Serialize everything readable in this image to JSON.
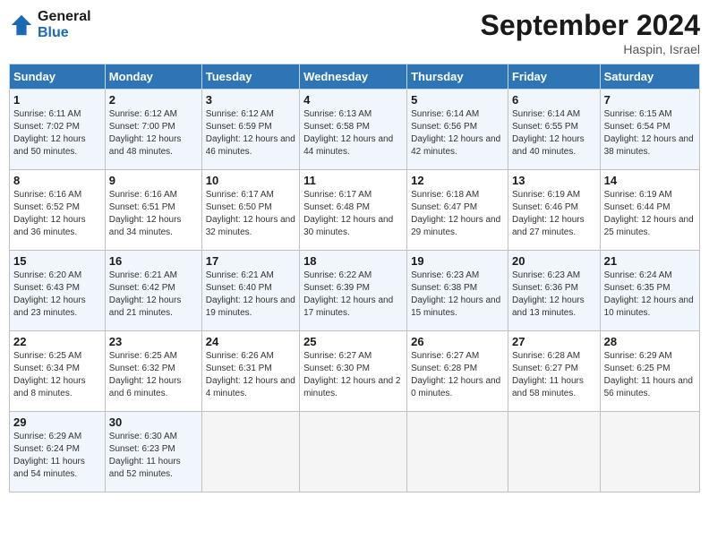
{
  "logo": {
    "line1": "General",
    "line2": "Blue"
  },
  "title": "September 2024",
  "location": "Haspin, Israel",
  "days_header": [
    "Sunday",
    "Monday",
    "Tuesday",
    "Wednesday",
    "Thursday",
    "Friday",
    "Saturday"
  ],
  "weeks": [
    [
      {
        "day": "1",
        "sunrise": "6:11 AM",
        "sunset": "7:02 PM",
        "daylight": "12 hours and 50 minutes."
      },
      {
        "day": "2",
        "sunrise": "6:12 AM",
        "sunset": "7:00 PM",
        "daylight": "12 hours and 48 minutes."
      },
      {
        "day": "3",
        "sunrise": "6:12 AM",
        "sunset": "6:59 PM",
        "daylight": "12 hours and 46 minutes."
      },
      {
        "day": "4",
        "sunrise": "6:13 AM",
        "sunset": "6:58 PM",
        "daylight": "12 hours and 44 minutes."
      },
      {
        "day": "5",
        "sunrise": "6:14 AM",
        "sunset": "6:56 PM",
        "daylight": "12 hours and 42 minutes."
      },
      {
        "day": "6",
        "sunrise": "6:14 AM",
        "sunset": "6:55 PM",
        "daylight": "12 hours and 40 minutes."
      },
      {
        "day": "7",
        "sunrise": "6:15 AM",
        "sunset": "6:54 PM",
        "daylight": "12 hours and 38 minutes."
      }
    ],
    [
      {
        "day": "8",
        "sunrise": "6:16 AM",
        "sunset": "6:52 PM",
        "daylight": "12 hours and 36 minutes."
      },
      {
        "day": "9",
        "sunrise": "6:16 AM",
        "sunset": "6:51 PM",
        "daylight": "12 hours and 34 minutes."
      },
      {
        "day": "10",
        "sunrise": "6:17 AM",
        "sunset": "6:50 PM",
        "daylight": "12 hours and 32 minutes."
      },
      {
        "day": "11",
        "sunrise": "6:17 AM",
        "sunset": "6:48 PM",
        "daylight": "12 hours and 30 minutes."
      },
      {
        "day": "12",
        "sunrise": "6:18 AM",
        "sunset": "6:47 PM",
        "daylight": "12 hours and 29 minutes."
      },
      {
        "day": "13",
        "sunrise": "6:19 AM",
        "sunset": "6:46 PM",
        "daylight": "12 hours and 27 minutes."
      },
      {
        "day": "14",
        "sunrise": "6:19 AM",
        "sunset": "6:44 PM",
        "daylight": "12 hours and 25 minutes."
      }
    ],
    [
      {
        "day": "15",
        "sunrise": "6:20 AM",
        "sunset": "6:43 PM",
        "daylight": "12 hours and 23 minutes."
      },
      {
        "day": "16",
        "sunrise": "6:21 AM",
        "sunset": "6:42 PM",
        "daylight": "12 hours and 21 minutes."
      },
      {
        "day": "17",
        "sunrise": "6:21 AM",
        "sunset": "6:40 PM",
        "daylight": "12 hours and 19 minutes."
      },
      {
        "day": "18",
        "sunrise": "6:22 AM",
        "sunset": "6:39 PM",
        "daylight": "12 hours and 17 minutes."
      },
      {
        "day": "19",
        "sunrise": "6:23 AM",
        "sunset": "6:38 PM",
        "daylight": "12 hours and 15 minutes."
      },
      {
        "day": "20",
        "sunrise": "6:23 AM",
        "sunset": "6:36 PM",
        "daylight": "12 hours and 13 minutes."
      },
      {
        "day": "21",
        "sunrise": "6:24 AM",
        "sunset": "6:35 PM",
        "daylight": "12 hours and 10 minutes."
      }
    ],
    [
      {
        "day": "22",
        "sunrise": "6:25 AM",
        "sunset": "6:34 PM",
        "daylight": "12 hours and 8 minutes."
      },
      {
        "day": "23",
        "sunrise": "6:25 AM",
        "sunset": "6:32 PM",
        "daylight": "12 hours and 6 minutes."
      },
      {
        "day": "24",
        "sunrise": "6:26 AM",
        "sunset": "6:31 PM",
        "daylight": "12 hours and 4 minutes."
      },
      {
        "day": "25",
        "sunrise": "6:27 AM",
        "sunset": "6:30 PM",
        "daylight": "12 hours and 2 minutes."
      },
      {
        "day": "26",
        "sunrise": "6:27 AM",
        "sunset": "6:28 PM",
        "daylight": "12 hours and 0 minutes."
      },
      {
        "day": "27",
        "sunrise": "6:28 AM",
        "sunset": "6:27 PM",
        "daylight": "11 hours and 58 minutes."
      },
      {
        "day": "28",
        "sunrise": "6:29 AM",
        "sunset": "6:25 PM",
        "daylight": "11 hours and 56 minutes."
      }
    ],
    [
      {
        "day": "29",
        "sunrise": "6:29 AM",
        "sunset": "6:24 PM",
        "daylight": "11 hours and 54 minutes."
      },
      {
        "day": "30",
        "sunrise": "6:30 AM",
        "sunset": "6:23 PM",
        "daylight": "11 hours and 52 minutes."
      },
      null,
      null,
      null,
      null,
      null
    ]
  ]
}
